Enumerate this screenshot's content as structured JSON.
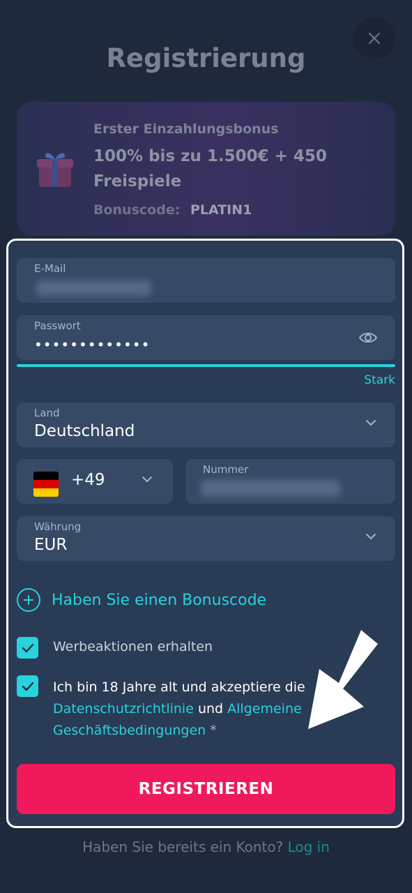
{
  "header": {
    "title": "Registrierung",
    "close_icon": "close-icon"
  },
  "bonus": {
    "label": "Erster Einzahlungsbonus",
    "amount": "100% bis zu 1.500€ + 450 Freispiele",
    "code_label": "Bonuscode:",
    "code_value": "PLATIN1",
    "icon": "gift-icon"
  },
  "form": {
    "email": {
      "label": "E-Mail"
    },
    "password": {
      "label": "Passwort",
      "value": "•••••••••••••",
      "icon": "eye-icon",
      "strength": "Stark"
    },
    "country": {
      "label": "Land",
      "value": "Deutschland",
      "icon": "chevron-down-icon"
    },
    "phone": {
      "dial_code": "+49",
      "flag": "germany-flag",
      "number_label": "Nummer"
    },
    "currency": {
      "label": "Währung",
      "value": "EUR",
      "icon": "chevron-down-icon"
    },
    "promo_link": "Haben Sie einen Bonuscode",
    "checkbox_promotions": {
      "label": "Werbeaktionen erhalten",
      "checked": true
    },
    "checkbox_terms": {
      "checked": true,
      "text_before": "Ich bin 18 Jahre alt und akzeptiere d",
      "text_cut": "ie",
      "privacy_link": "Datenschutzrichtlinie",
      "and": "und",
      "terms_link_part1": "Allgemeine",
      "terms_link_part2": "Geschäftsbedingungen",
      "required": "*"
    },
    "submit": "REGISTRIEREN"
  },
  "footer": {
    "question": "Haben Sie bereits ein Konto?",
    "login_link": "Log in"
  },
  "colors": {
    "accent": "#27d3dc",
    "button": "#f0195c",
    "background": "#1e2a3b",
    "field": "#364a66"
  }
}
